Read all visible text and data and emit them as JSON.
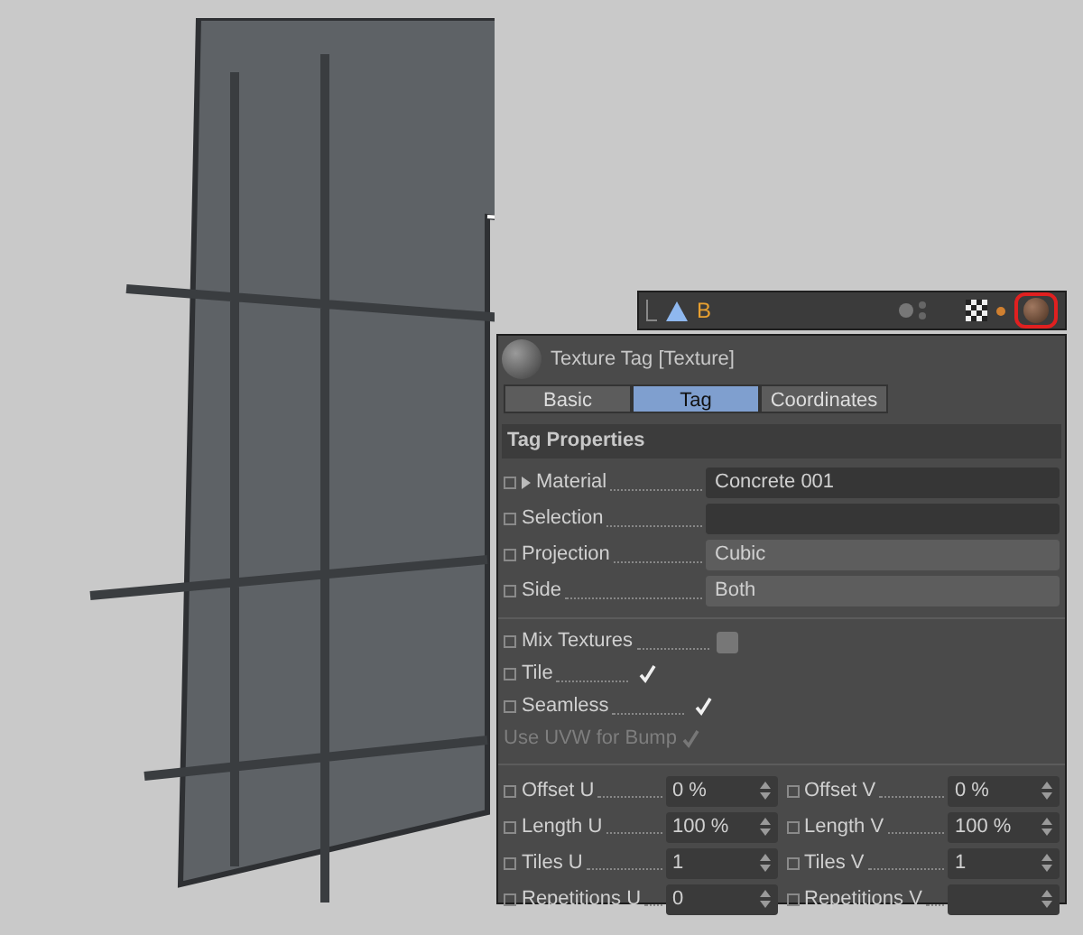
{
  "object_row": {
    "name": "B"
  },
  "panel": {
    "title": "Texture Tag [Texture]",
    "tabs": [
      {
        "label": "Basic",
        "selected": false
      },
      {
        "label": "Tag",
        "selected": true
      },
      {
        "label": "Coordinates",
        "selected": false
      }
    ],
    "section": "Tag Properties",
    "fields": [
      {
        "kind": "link",
        "label": "Material",
        "value": "Concrete 001",
        "expandable": true
      },
      {
        "kind": "link",
        "label": "Selection",
        "expandable": false
      },
      {
        "kind": "dropdown",
        "label": "Projection",
        "value": "Cubic",
        "expandable": false
      },
      {
        "kind": "dropdown",
        "label": "Side",
        "value": "Both",
        "expandable": false
      }
    ],
    "checkboxes": [
      {
        "label": "Mix Textures",
        "checked": false,
        "disabled": false
      },
      {
        "label": "Tile",
        "checked": true,
        "disabled": false
      },
      {
        "label": "Seamless",
        "checked": true,
        "disabled": false
      },
      {
        "label": "Use UVW for Bump",
        "checked": true,
        "disabled": true
      }
    ],
    "numbers": [
      {
        "label": "Offset U",
        "value": "0 %"
      },
      {
        "label": "Offset V",
        "value": "0 %"
      },
      {
        "label": "Length U",
        "value": "100 %"
      },
      {
        "label": "Length V",
        "value": "100 %"
      },
      {
        "label": "Tiles U",
        "value": "1"
      },
      {
        "label": "Tiles V",
        "value": "1"
      },
      {
        "label": "Repetitions U",
        "value": "0"
      },
      {
        "label": "Repetitions V"
      }
    ]
  }
}
